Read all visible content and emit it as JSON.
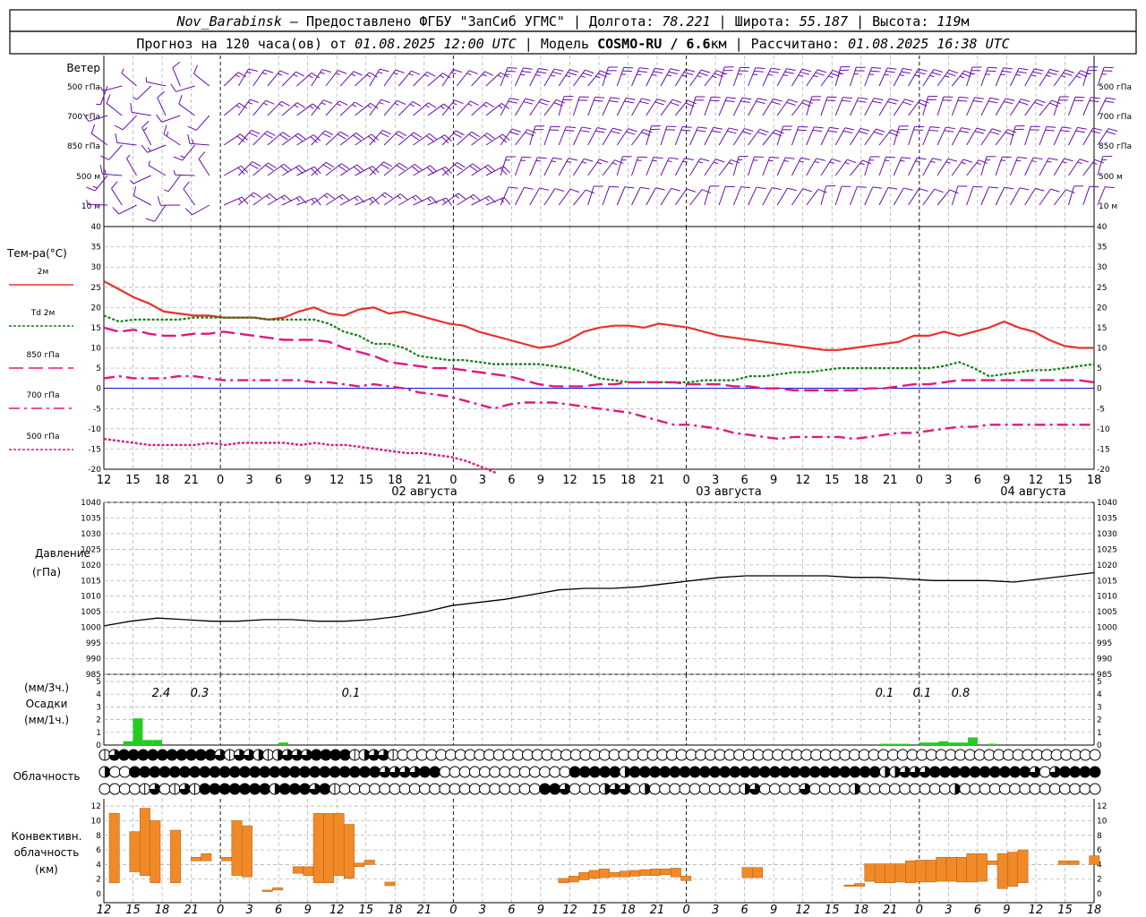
{
  "header": {
    "station": "Nov_Barabinsk",
    "provider": " — Предоставлено ФГБУ \"ЗапСиб УГМС\" | Долгота: ",
    "lon": "78.221",
    "lat_label": " | Широта: ",
    "lat": "55.187",
    "alt_label": " | Высота: ",
    "alt": "119",
    "alt_unit": "м",
    "line2_a": "Прогноз на 120 часа(ов) от ",
    "issued": "01.08.2025 12:00 UTC",
    "line2_b": " | Модель ",
    "model": "COSMO-RU / 6.6",
    "model_unit": "км",
    "line2_c": " | Рассчитано: ",
    "computed": "01.08.2025 16:38 UTC"
  },
  "labels": {
    "wind": "Ветер",
    "wind_levels": [
      "500 гПа",
      "700 гПа",
      "850 гПа",
      "500 м",
      "10  м"
    ],
    "temp_title": "Тем-ра(°C)",
    "temp_legend": [
      "2м",
      "Td  2м",
      "850 гПа",
      "700 гПа",
      "500 гПа"
    ],
    "pressure_title": "Давление",
    "pressure_unit": "(гПа)",
    "precip_top": "(мм/3ч.)",
    "precip_title": "Осадки",
    "precip_bottom": "(мм/1ч.)",
    "cloud_title": "Облачность",
    "conv_title": [
      "Конвективн.",
      "облачность",
      "(км)"
    ],
    "dates": [
      "02 августа",
      "03 августа",
      "04 августа"
    ]
  },
  "colors": {
    "wind": "#6a0dad",
    "t2m": "#e8322e",
    "td2m": "#108010",
    "t850": "#e01880",
    "t700": "#e01880",
    "t500": "#e01880",
    "zero": "#0000cc",
    "precip": "#22cc22",
    "conv": "#f08a28",
    "pressure": "#000000"
  },
  "chart_data": [
    {
      "type": "line",
      "name": "temperature",
      "x_ticks": [
        "12",
        "15",
        "18",
        "21",
        "0",
        "3",
        "6",
        "9",
        "12",
        "15",
        "18",
        "21",
        "0",
        "3",
        "6",
        "9",
        "12",
        "15",
        "18",
        "21",
        "0",
        "3",
        "6",
        "9",
        "12",
        "15",
        "18"
      ],
      "ylim": [
        -20,
        40
      ],
      "yticks": [
        -20,
        -15,
        -10,
        -5,
        0,
        5,
        10,
        15,
        20,
        25,
        30,
        35,
        40
      ],
      "series": [
        {
          "name": "2м",
          "values": [
            26.5,
            24.5,
            22.5,
            21,
            19,
            18.5,
            18,
            18,
            17.5,
            17.5,
            17.5,
            17,
            17.5,
            19,
            20,
            18.5,
            18,
            19.5,
            20,
            18.5,
            19,
            18,
            17,
            16,
            15.5,
            14,
            13,
            12,
            11,
            10,
            10.5,
            12,
            14,
            15,
            15.5,
            15.5,
            15,
            16,
            15.5,
            15,
            14,
            13,
            12.5,
            12,
            11.5,
            11,
            10.5,
            10,
            9.5,
            9.5,
            10,
            10.5,
            11,
            11.5,
            13,
            13,
            14,
            13,
            14,
            15,
            16.5,
            15,
            14,
            12,
            10.5,
            10,
            10
          ]
        },
        {
          "name": "Td  2м",
          "values": [
            18,
            16.5,
            17,
            17,
            17,
            17,
            17.5,
            17.5,
            17.5,
            17.5,
            17.5,
            17,
            17,
            17,
            17,
            16,
            14,
            13,
            11,
            11,
            10,
            8,
            7.5,
            7,
            7,
            6.5,
            6,
            6,
            6,
            6,
            5.5,
            5,
            4,
            2.5,
            2,
            1.5,
            1.5,
            1.5,
            1.5,
            1.5,
            2,
            2,
            2,
            3,
            3,
            3.5,
            4,
            4,
            4.5,
            5,
            5,
            5,
            5,
            5,
            5,
            5,
            5.5,
            6.5,
            5,
            3,
            3.5,
            4,
            4.5,
            4.5,
            5,
            5.5,
            6
          ]
        },
        {
          "name": "850 гПа",
          "values": [
            15,
            14,
            14.5,
            13.5,
            13,
            13,
            13.5,
            13.5,
            14,
            13.5,
            13,
            12.5,
            12,
            12,
            12,
            11.5,
            10,
            9,
            8,
            6.5,
            6,
            5.5,
            5,
            5,
            4.5,
            4,
            3.5,
            3,
            2,
            1,
            0.5,
            0.5,
            0.5,
            1,
            1,
            1.5,
            1.5,
            1.5,
            1.5,
            1,
            1,
            1,
            0.5,
            0.5,
            0,
            0,
            -0.5,
            -0.5,
            -0.5,
            -0.5,
            -0.5,
            0,
            0,
            0.5,
            1,
            1,
            1.5,
            2,
            2,
            2,
            2,
            2,
            2,
            2,
            2,
            2,
            1.5
          ]
        },
        {
          "name": "700 гПа",
          "values": [
            2.5,
            3,
            2.5,
            2.5,
            2.5,
            3,
            3,
            2.5,
            2,
            2,
            2,
            2,
            2,
            2,
            1.5,
            1.5,
            1,
            0.5,
            1,
            0.5,
            0,
            -1,
            -1.5,
            -2,
            -3,
            -4,
            -5,
            -4,
            -3.5,
            -3.5,
            -3.5,
            -4,
            -4.5,
            -5,
            -5.5,
            -6,
            -7,
            -8,
            -9,
            -9,
            -9.5,
            -10,
            -11,
            -11.5,
            -12,
            -12.5,
            -12,
            -12,
            -12,
            -12,
            -12.5,
            -12,
            -11.5,
            -11,
            -11,
            -10.5,
            -10,
            -9.5,
            -9.5,
            -9,
            -9,
            -9,
            -9,
            -9,
            -9,
            -9,
            -9
          ]
        },
        {
          "name": "500 гПа",
          "values": [
            -12.5,
            -13,
            -13.5,
            -14,
            -14,
            -14,
            -14,
            -13.5,
            -14,
            -13.5,
            -13.5,
            -13.5,
            -13.5,
            -14,
            -13.5,
            -14,
            -14,
            -14.5,
            -15,
            -15.5,
            -16,
            -16,
            -16.5,
            -17,
            -18,
            -19.5,
            -21
          ]
        }
      ]
    },
    {
      "type": "line",
      "name": "pressure",
      "ylim": [
        985,
        1040
      ],
      "yticks": [
        985,
        990,
        995,
        1000,
        1005,
        1010,
        1015,
        1020,
        1025,
        1030,
        1035,
        1040
      ],
      "series": [
        {
          "name": "Давление",
          "values": [
            1000.5,
            1002,
            1003,
            1002.5,
            1002,
            1002,
            1002.5,
            1002.5,
            1002,
            1002,
            1002.5,
            1003.5,
            1005,
            1007,
            1008,
            1009,
            1010.5,
            1012,
            1012.5,
            1012.5,
            1013,
            1014,
            1015,
            1016,
            1016.5,
            1016.5,
            1016.5,
            1016.5,
            1016,
            1016,
            1015.5,
            1015,
            1015,
            1015,
            1014.5,
            1015.5,
            1016.5,
            1017.5
          ]
        }
      ]
    },
    {
      "type": "bar",
      "name": "precipitation",
      "ylim": [
        0,
        5
      ],
      "yticks": [
        0,
        1,
        2,
        3,
        4,
        5
      ],
      "annotations": [
        "2.4",
        "0.3",
        "0.1",
        "0.1",
        "0.1",
        "0.8"
      ],
      "values": [
        0,
        0,
        0.3,
        2.1,
        0.4,
        0.4,
        0,
        0,
        0,
        0,
        0,
        0,
        0,
        0,
        0,
        0,
        0,
        0,
        0.2,
        0,
        0,
        0,
        0,
        0,
        0,
        0,
        0,
        0,
        0,
        0,
        0,
        0,
        0,
        0,
        0,
        0,
        0,
        0,
        0,
        0,
        0,
        0,
        0,
        0,
        0,
        0,
        0,
        0,
        0,
        0,
        0,
        0,
        0,
        0,
        0,
        0,
        0,
        0,
        0,
        0,
        0,
        0,
        0,
        0,
        0,
        0,
        0,
        0,
        0,
        0,
        0,
        0,
        0,
        0,
        0,
        0,
        0,
        0,
        0,
        0,
        0.1,
        0.1,
        0.1,
        0,
        0.2,
        0.2,
        0.3,
        0.2,
        0.2,
        0.6,
        0,
        0.1,
        0,
        0,
        0,
        0,
        0,
        0,
        0,
        0,
        0,
        0
      ]
    },
    {
      "type": "table",
      "name": "cloudiness",
      "rows": [
        [
          1,
          3,
          4,
          4,
          4,
          4,
          4,
          4,
          4,
          4,
          4,
          4,
          3,
          1,
          3,
          3,
          2,
          1,
          2,
          3,
          3,
          3,
          4,
          4,
          4,
          4,
          1,
          2,
          3,
          3,
          1,
          0,
          0,
          0,
          0,
          0,
          0,
          0,
          0,
          0,
          0,
          0,
          0,
          0,
          0,
          0,
          0,
          0,
          0,
          0,
          0,
          0,
          0,
          0,
          0,
          0,
          0,
          0,
          0,
          0,
          0,
          0,
          0,
          0,
          0,
          0,
          0,
          0,
          0,
          0,
          0,
          0,
          0,
          0,
          0,
          0,
          0,
          0,
          0,
          0,
          0,
          0,
          0,
          0,
          0,
          0,
          0,
          0,
          0,
          0,
          0,
          0,
          0,
          0,
          0,
          0,
          0,
          0,
          0,
          0,
          0,
          0,
          0,
          0
        ],
        [
          2,
          0,
          0,
          4,
          4,
          4,
          4,
          4,
          4,
          4,
          4,
          4,
          4,
          4,
          4,
          4,
          4,
          4,
          4,
          4,
          4,
          4,
          4,
          4,
          4,
          4,
          4,
          4,
          3,
          3,
          3,
          3,
          4,
          4,
          0,
          0,
          0,
          0,
          0,
          0,
          0,
          0,
          0,
          0,
          0,
          0,
          0,
          4,
          4,
          4,
          4,
          4,
          2,
          4,
          4,
          4,
          4,
          4,
          4,
          4,
          4,
          4,
          4,
          4,
          4,
          4,
          4,
          4,
          4,
          4,
          4,
          4,
          4,
          4,
          4,
          4,
          4,
          4,
          2,
          2,
          3,
          3,
          3,
          4,
          4,
          4,
          4,
          4,
          4,
          4,
          4,
          4,
          4,
          3,
          0,
          3,
          4,
          4,
          4,
          4
        ],
        [
          0,
          0,
          0,
          0,
          1,
          3,
          0,
          1,
          3,
          1,
          4,
          4,
          4,
          4,
          4,
          4,
          4,
          2,
          4,
          4,
          4,
          3,
          4,
          1,
          0,
          0,
          0,
          0,
          0,
          0,
          0,
          0,
          0,
          0,
          0,
          0,
          0,
          0,
          0,
          0,
          0,
          0,
          0,
          0,
          4,
          4,
          3,
          0,
          0,
          0,
          2,
          3,
          3,
          0,
          2,
          0,
          0,
          0,
          0,
          0,
          0,
          0,
          0,
          0,
          2,
          3,
          0,
          0,
          0,
          0,
          3,
          0,
          0,
          0,
          0,
          2,
          0,
          0,
          0,
          0,
          0,
          0,
          0,
          0,
          0,
          2,
          0,
          0,
          0,
          0,
          0,
          0,
          0,
          0,
          0,
          0,
          0,
          0,
          0,
          0
        ]
      ]
    },
    {
      "type": "bar",
      "name": "convective cloud",
      "ylim": [
        0,
        13
      ],
      "yticks": [
        0,
        2,
        4,
        6,
        8,
        10,
        12
      ],
      "segments": [
        [
          1.5,
          11
        ],
        [
          0,
          0
        ],
        [
          3,
          8.5
        ],
        [
          2.5,
          11.7
        ],
        [
          1.5,
          10
        ],
        [
          0,
          0
        ],
        [
          1.5,
          8.7
        ],
        [
          0,
          0
        ],
        [
          4.5,
          5
        ],
        [
          4.5,
          5.5
        ],
        [
          0,
          0
        ],
        [
          4.5,
          5
        ],
        [
          2.5,
          10
        ],
        [
          2.3,
          9.3
        ],
        [
          0,
          0
        ],
        [
          0.3,
          0.5
        ],
        [
          0.5,
          0.8
        ],
        [
          0,
          0
        ],
        [
          2.8,
          3.7
        ],
        [
          2.5,
          3.7
        ],
        [
          1.5,
          11
        ],
        [
          1.5,
          11
        ],
        [
          2.5,
          11
        ],
        [
          2.1,
          9.5
        ],
        [
          3.7,
          4.2
        ],
        [
          4.0,
          4.6
        ],
        [
          0,
          0
        ],
        [
          1.1,
          1.6
        ],
        [
          0,
          0
        ],
        [
          0,
          0
        ],
        [
          0,
          0
        ],
        [
          0,
          0
        ],
        [
          0,
          0
        ],
        [
          0,
          0
        ],
        [
          0,
          0
        ],
        [
          0,
          0
        ],
        [
          0,
          0
        ],
        [
          0,
          0
        ],
        [
          0,
          0
        ],
        [
          0,
          0
        ],
        [
          0,
          0
        ],
        [
          0,
          0
        ],
        [
          0,
          0
        ],
        [
          0,
          0
        ],
        [
          1.5,
          2.1
        ],
        [
          1.6,
          2.4
        ],
        [
          1.9,
          2.9
        ],
        [
          2.1,
          3.2
        ],
        [
          2.2,
          3.4
        ],
        [
          2.3,
          2.9
        ],
        [
          2.3,
          3.1
        ],
        [
          2.4,
          3.2
        ],
        [
          2.5,
          3.3
        ],
        [
          2.5,
          3.4
        ],
        [
          2.6,
          3.4
        ],
        [
          2.3,
          3.5
        ],
        [
          1.8,
          2.4
        ],
        [
          0,
          0
        ],
        [
          0,
          0
        ],
        [
          0,
          0
        ],
        [
          0,
          0
        ],
        [
          0,
          0
        ],
        [
          2.2,
          3.6
        ],
        [
          2.2,
          3.6
        ],
        [
          0,
          0
        ],
        [
          0,
          0
        ],
        [
          0,
          0
        ],
        [
          0,
          0
        ],
        [
          0,
          0
        ],
        [
          0,
          0
        ],
        [
          0,
          0
        ],
        [
          0,
          0
        ],
        [
          1.0,
          1.2
        ],
        [
          1.0,
          1.4
        ],
        [
          1.7,
          4.1
        ],
        [
          1.5,
          4.1
        ],
        [
          1.5,
          4.1
        ],
        [
          1.6,
          4.1
        ],
        [
          1.5,
          4.5
        ],
        [
          1.6,
          4.6
        ],
        [
          1.6,
          4.6
        ],
        [
          1.7,
          5
        ],
        [
          1.7,
          5
        ],
        [
          1.6,
          5
        ],
        [
          1.6,
          5.5
        ],
        [
          1.7,
          5.5
        ],
        [
          4,
          4.5
        ],
        [
          0.7,
          5.5
        ],
        [
          1,
          5.7
        ],
        [
          1.5,
          6
        ],
        [
          0,
          0
        ],
        [
          0,
          0
        ],
        [
          0,
          0
        ],
        [
          4,
          4.5
        ],
        [
          4,
          4.5
        ],
        [
          0,
          0
        ],
        [
          4,
          5.2
        ]
      ]
    }
  ]
}
